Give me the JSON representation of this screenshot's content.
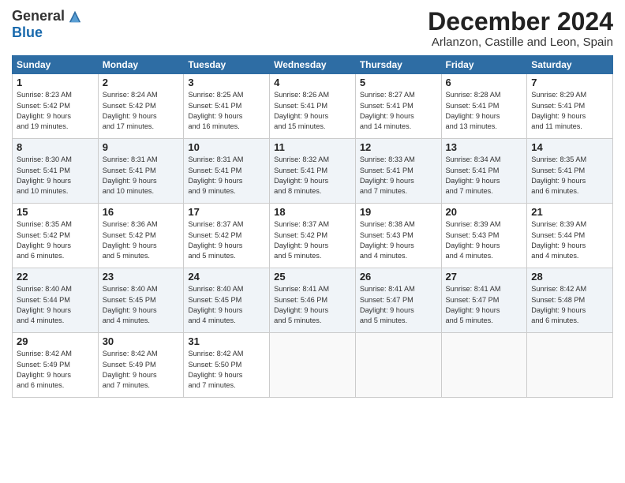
{
  "logo": {
    "general": "General",
    "blue": "Blue"
  },
  "title": "December 2024",
  "location": "Arlanzon, Castille and Leon, Spain",
  "days_of_week": [
    "Sunday",
    "Monday",
    "Tuesday",
    "Wednesday",
    "Thursday",
    "Friday",
    "Saturday"
  ],
  "weeks": [
    [
      {
        "day": "1",
        "info": "Sunrise: 8:23 AM\nSunset: 5:42 PM\nDaylight: 9 hours\nand 19 minutes."
      },
      {
        "day": "2",
        "info": "Sunrise: 8:24 AM\nSunset: 5:42 PM\nDaylight: 9 hours\nand 17 minutes."
      },
      {
        "day": "3",
        "info": "Sunrise: 8:25 AM\nSunset: 5:41 PM\nDaylight: 9 hours\nand 16 minutes."
      },
      {
        "day": "4",
        "info": "Sunrise: 8:26 AM\nSunset: 5:41 PM\nDaylight: 9 hours\nand 15 minutes."
      },
      {
        "day": "5",
        "info": "Sunrise: 8:27 AM\nSunset: 5:41 PM\nDaylight: 9 hours\nand 14 minutes."
      },
      {
        "day": "6",
        "info": "Sunrise: 8:28 AM\nSunset: 5:41 PM\nDaylight: 9 hours\nand 13 minutes."
      },
      {
        "day": "7",
        "info": "Sunrise: 8:29 AM\nSunset: 5:41 PM\nDaylight: 9 hours\nand 11 minutes."
      }
    ],
    [
      {
        "day": "8",
        "info": "Sunrise: 8:30 AM\nSunset: 5:41 PM\nDaylight: 9 hours\nand 10 minutes."
      },
      {
        "day": "9",
        "info": "Sunrise: 8:31 AM\nSunset: 5:41 PM\nDaylight: 9 hours\nand 10 minutes."
      },
      {
        "day": "10",
        "info": "Sunrise: 8:31 AM\nSunset: 5:41 PM\nDaylight: 9 hours\nand 9 minutes."
      },
      {
        "day": "11",
        "info": "Sunrise: 8:32 AM\nSunset: 5:41 PM\nDaylight: 9 hours\nand 8 minutes."
      },
      {
        "day": "12",
        "info": "Sunrise: 8:33 AM\nSunset: 5:41 PM\nDaylight: 9 hours\nand 7 minutes."
      },
      {
        "day": "13",
        "info": "Sunrise: 8:34 AM\nSunset: 5:41 PM\nDaylight: 9 hours\nand 7 minutes."
      },
      {
        "day": "14",
        "info": "Sunrise: 8:35 AM\nSunset: 5:41 PM\nDaylight: 9 hours\nand 6 minutes."
      }
    ],
    [
      {
        "day": "15",
        "info": "Sunrise: 8:35 AM\nSunset: 5:42 PM\nDaylight: 9 hours\nand 6 minutes."
      },
      {
        "day": "16",
        "info": "Sunrise: 8:36 AM\nSunset: 5:42 PM\nDaylight: 9 hours\nand 5 minutes."
      },
      {
        "day": "17",
        "info": "Sunrise: 8:37 AM\nSunset: 5:42 PM\nDaylight: 9 hours\nand 5 minutes."
      },
      {
        "day": "18",
        "info": "Sunrise: 8:37 AM\nSunset: 5:42 PM\nDaylight: 9 hours\nand 5 minutes."
      },
      {
        "day": "19",
        "info": "Sunrise: 8:38 AM\nSunset: 5:43 PM\nDaylight: 9 hours\nand 4 minutes."
      },
      {
        "day": "20",
        "info": "Sunrise: 8:39 AM\nSunset: 5:43 PM\nDaylight: 9 hours\nand 4 minutes."
      },
      {
        "day": "21",
        "info": "Sunrise: 8:39 AM\nSunset: 5:44 PM\nDaylight: 9 hours\nand 4 minutes."
      }
    ],
    [
      {
        "day": "22",
        "info": "Sunrise: 8:40 AM\nSunset: 5:44 PM\nDaylight: 9 hours\nand 4 minutes."
      },
      {
        "day": "23",
        "info": "Sunrise: 8:40 AM\nSunset: 5:45 PM\nDaylight: 9 hours\nand 4 minutes."
      },
      {
        "day": "24",
        "info": "Sunrise: 8:40 AM\nSunset: 5:45 PM\nDaylight: 9 hours\nand 4 minutes."
      },
      {
        "day": "25",
        "info": "Sunrise: 8:41 AM\nSunset: 5:46 PM\nDaylight: 9 hours\nand 5 minutes."
      },
      {
        "day": "26",
        "info": "Sunrise: 8:41 AM\nSunset: 5:47 PM\nDaylight: 9 hours\nand 5 minutes."
      },
      {
        "day": "27",
        "info": "Sunrise: 8:41 AM\nSunset: 5:47 PM\nDaylight: 9 hours\nand 5 minutes."
      },
      {
        "day": "28",
        "info": "Sunrise: 8:42 AM\nSunset: 5:48 PM\nDaylight: 9 hours\nand 6 minutes."
      }
    ],
    [
      {
        "day": "29",
        "info": "Sunrise: 8:42 AM\nSunset: 5:49 PM\nDaylight: 9 hours\nand 6 minutes."
      },
      {
        "day": "30",
        "info": "Sunrise: 8:42 AM\nSunset: 5:49 PM\nDaylight: 9 hours\nand 7 minutes."
      },
      {
        "day": "31",
        "info": "Sunrise: 8:42 AM\nSunset: 5:50 PM\nDaylight: 9 hours\nand 7 minutes."
      },
      {
        "day": "",
        "info": ""
      },
      {
        "day": "",
        "info": ""
      },
      {
        "day": "",
        "info": ""
      },
      {
        "day": "",
        "info": ""
      }
    ]
  ]
}
